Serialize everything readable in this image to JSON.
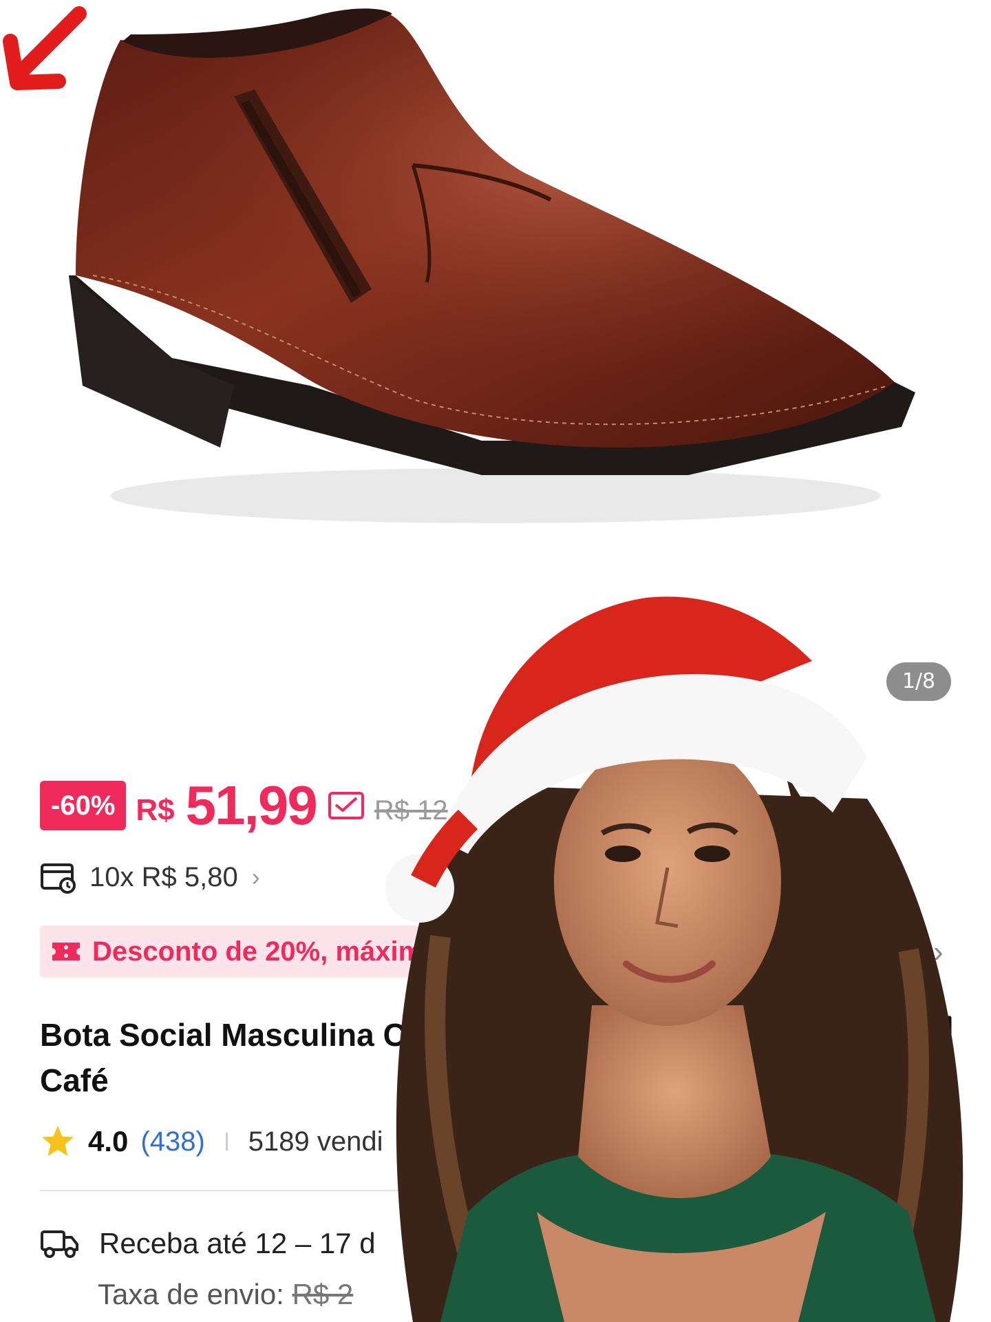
{
  "gallery": {
    "page_indicator": "1/8"
  },
  "price": {
    "discount_badge": "-60%",
    "currency": "R$",
    "current": "51,99",
    "original": "R$ 12"
  },
  "installments": {
    "text": "10x R$ 5,80",
    "chevron": "›"
  },
  "coupon_banner": {
    "text": "Desconto de 20%, máximo",
    "chevron": "›"
  },
  "product": {
    "title_line1": "Bota Social Masculina Co",
    "title_line2": "Café"
  },
  "rating": {
    "value": "4.0",
    "reviews": "(438)",
    "sold": "5189 vendi"
  },
  "delivery": {
    "text": "Receba até 12 – 17 d",
    "fee_label": "Taxa de envio:",
    "fee_value": "R$ 2"
  },
  "colors": {
    "accent": "#ef2a5c",
    "banner_bg": "#fde4ea",
    "link": "#2f6fd6",
    "shoe_leather": "#7a2a1a",
    "star": "#f6c21c"
  }
}
